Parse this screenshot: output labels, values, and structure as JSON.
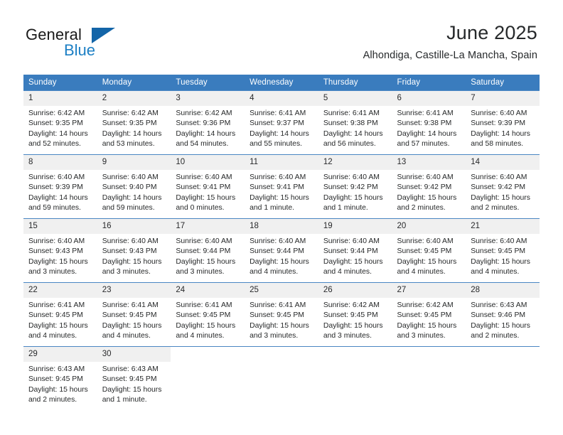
{
  "brand": {
    "name_part1": "General",
    "name_part2": "Blue",
    "triangle_color": "#1365a8",
    "blue_color": "#1c7fc4"
  },
  "header": {
    "title": "June 2025",
    "subtitle": "Alhondiga, Castille-La Mancha, Spain"
  },
  "theme": {
    "header_row_bg": "#3a7cbe",
    "day_number_bg": "#f0f0f0",
    "row_divider": "#4a86c3",
    "text_color": "#262829"
  },
  "weekday_headers": [
    "Sunday",
    "Monday",
    "Tuesday",
    "Wednesday",
    "Thursday",
    "Friday",
    "Saturday"
  ],
  "weeks": [
    [
      {
        "day": "1",
        "sunrise": "Sunrise: 6:42 AM",
        "sunset": "Sunset: 9:35 PM",
        "daylight": "Daylight: 14 hours and 52 minutes."
      },
      {
        "day": "2",
        "sunrise": "Sunrise: 6:42 AM",
        "sunset": "Sunset: 9:35 PM",
        "daylight": "Daylight: 14 hours and 53 minutes."
      },
      {
        "day": "3",
        "sunrise": "Sunrise: 6:42 AM",
        "sunset": "Sunset: 9:36 PM",
        "daylight": "Daylight: 14 hours and 54 minutes."
      },
      {
        "day": "4",
        "sunrise": "Sunrise: 6:41 AM",
        "sunset": "Sunset: 9:37 PM",
        "daylight": "Daylight: 14 hours and 55 minutes."
      },
      {
        "day": "5",
        "sunrise": "Sunrise: 6:41 AM",
        "sunset": "Sunset: 9:38 PM",
        "daylight": "Daylight: 14 hours and 56 minutes."
      },
      {
        "day": "6",
        "sunrise": "Sunrise: 6:41 AM",
        "sunset": "Sunset: 9:38 PM",
        "daylight": "Daylight: 14 hours and 57 minutes."
      },
      {
        "day": "7",
        "sunrise": "Sunrise: 6:40 AM",
        "sunset": "Sunset: 9:39 PM",
        "daylight": "Daylight: 14 hours and 58 minutes."
      }
    ],
    [
      {
        "day": "8",
        "sunrise": "Sunrise: 6:40 AM",
        "sunset": "Sunset: 9:39 PM",
        "daylight": "Daylight: 14 hours and 59 minutes."
      },
      {
        "day": "9",
        "sunrise": "Sunrise: 6:40 AM",
        "sunset": "Sunset: 9:40 PM",
        "daylight": "Daylight: 14 hours and 59 minutes."
      },
      {
        "day": "10",
        "sunrise": "Sunrise: 6:40 AM",
        "sunset": "Sunset: 9:41 PM",
        "daylight": "Daylight: 15 hours and 0 minutes."
      },
      {
        "day": "11",
        "sunrise": "Sunrise: 6:40 AM",
        "sunset": "Sunset: 9:41 PM",
        "daylight": "Daylight: 15 hours and 1 minute."
      },
      {
        "day": "12",
        "sunrise": "Sunrise: 6:40 AM",
        "sunset": "Sunset: 9:42 PM",
        "daylight": "Daylight: 15 hours and 1 minute."
      },
      {
        "day": "13",
        "sunrise": "Sunrise: 6:40 AM",
        "sunset": "Sunset: 9:42 PM",
        "daylight": "Daylight: 15 hours and 2 minutes."
      },
      {
        "day": "14",
        "sunrise": "Sunrise: 6:40 AM",
        "sunset": "Sunset: 9:42 PM",
        "daylight": "Daylight: 15 hours and 2 minutes."
      }
    ],
    [
      {
        "day": "15",
        "sunrise": "Sunrise: 6:40 AM",
        "sunset": "Sunset: 9:43 PM",
        "daylight": "Daylight: 15 hours and 3 minutes."
      },
      {
        "day": "16",
        "sunrise": "Sunrise: 6:40 AM",
        "sunset": "Sunset: 9:43 PM",
        "daylight": "Daylight: 15 hours and 3 minutes."
      },
      {
        "day": "17",
        "sunrise": "Sunrise: 6:40 AM",
        "sunset": "Sunset: 9:44 PM",
        "daylight": "Daylight: 15 hours and 3 minutes."
      },
      {
        "day": "18",
        "sunrise": "Sunrise: 6:40 AM",
        "sunset": "Sunset: 9:44 PM",
        "daylight": "Daylight: 15 hours and 4 minutes."
      },
      {
        "day": "19",
        "sunrise": "Sunrise: 6:40 AM",
        "sunset": "Sunset: 9:44 PM",
        "daylight": "Daylight: 15 hours and 4 minutes."
      },
      {
        "day": "20",
        "sunrise": "Sunrise: 6:40 AM",
        "sunset": "Sunset: 9:45 PM",
        "daylight": "Daylight: 15 hours and 4 minutes."
      },
      {
        "day": "21",
        "sunrise": "Sunrise: 6:40 AM",
        "sunset": "Sunset: 9:45 PM",
        "daylight": "Daylight: 15 hours and 4 minutes."
      }
    ],
    [
      {
        "day": "22",
        "sunrise": "Sunrise: 6:41 AM",
        "sunset": "Sunset: 9:45 PM",
        "daylight": "Daylight: 15 hours and 4 minutes."
      },
      {
        "day": "23",
        "sunrise": "Sunrise: 6:41 AM",
        "sunset": "Sunset: 9:45 PM",
        "daylight": "Daylight: 15 hours and 4 minutes."
      },
      {
        "day": "24",
        "sunrise": "Sunrise: 6:41 AM",
        "sunset": "Sunset: 9:45 PM",
        "daylight": "Daylight: 15 hours and 4 minutes."
      },
      {
        "day": "25",
        "sunrise": "Sunrise: 6:41 AM",
        "sunset": "Sunset: 9:45 PM",
        "daylight": "Daylight: 15 hours and 3 minutes."
      },
      {
        "day": "26",
        "sunrise": "Sunrise: 6:42 AM",
        "sunset": "Sunset: 9:45 PM",
        "daylight": "Daylight: 15 hours and 3 minutes."
      },
      {
        "day": "27",
        "sunrise": "Sunrise: 6:42 AM",
        "sunset": "Sunset: 9:45 PM",
        "daylight": "Daylight: 15 hours and 3 minutes."
      },
      {
        "day": "28",
        "sunrise": "Sunrise: 6:43 AM",
        "sunset": "Sunset: 9:46 PM",
        "daylight": "Daylight: 15 hours and 2 minutes."
      }
    ],
    [
      {
        "day": "29",
        "sunrise": "Sunrise: 6:43 AM",
        "sunset": "Sunset: 9:45 PM",
        "daylight": "Daylight: 15 hours and 2 minutes."
      },
      {
        "day": "30",
        "sunrise": "Sunrise: 6:43 AM",
        "sunset": "Sunset: 9:45 PM",
        "daylight": "Daylight: 15 hours and 1 minute."
      },
      {
        "day": "",
        "sunrise": "",
        "sunset": "",
        "daylight": ""
      },
      {
        "day": "",
        "sunrise": "",
        "sunset": "",
        "daylight": ""
      },
      {
        "day": "",
        "sunrise": "",
        "sunset": "",
        "daylight": ""
      },
      {
        "day": "",
        "sunrise": "",
        "sunset": "",
        "daylight": ""
      },
      {
        "day": "",
        "sunrise": "",
        "sunset": "",
        "daylight": ""
      }
    ]
  ]
}
